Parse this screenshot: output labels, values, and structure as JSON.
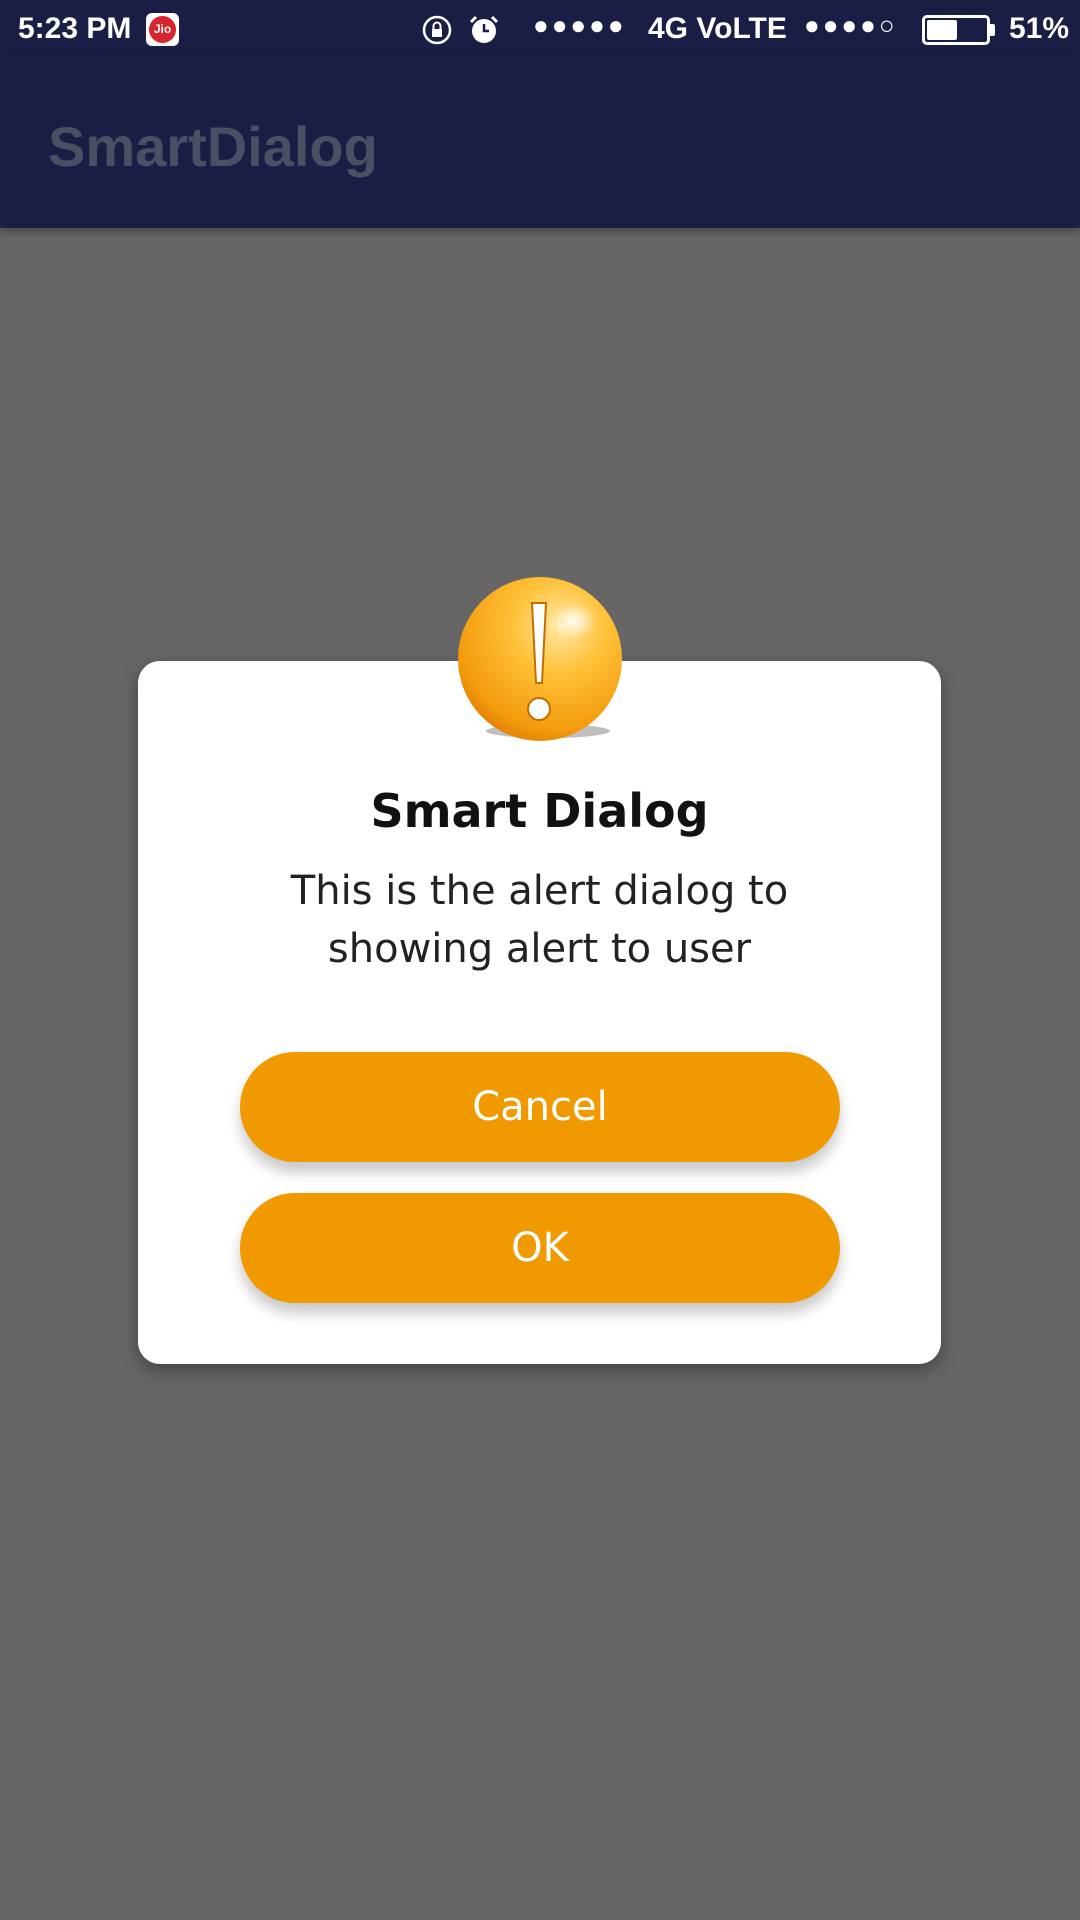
{
  "status_bar": {
    "time": "5:23 PM",
    "carrier_badge": "Jio",
    "signal_dots_1": "●●●●●",
    "network": "4G VoLTE",
    "signal_dots_2": "●●●●○",
    "battery": "51%",
    "battery_level": 0.51,
    "icons": [
      "rotation-lock-icon",
      "alarm-icon",
      "battery-icon"
    ]
  },
  "app_bar": {
    "title": "SmartDialog"
  },
  "dialog": {
    "icon": "exclamation-icon",
    "title": "Smart Dialog",
    "message": "This is the alert dialog to showing alert to user",
    "cancel_label": "Cancel",
    "ok_label": "OK"
  },
  "colors": {
    "bar": "#1a1e44",
    "scrim": "#666666",
    "accent": "#f09900",
    "dialog_bg": "#ffffff"
  }
}
